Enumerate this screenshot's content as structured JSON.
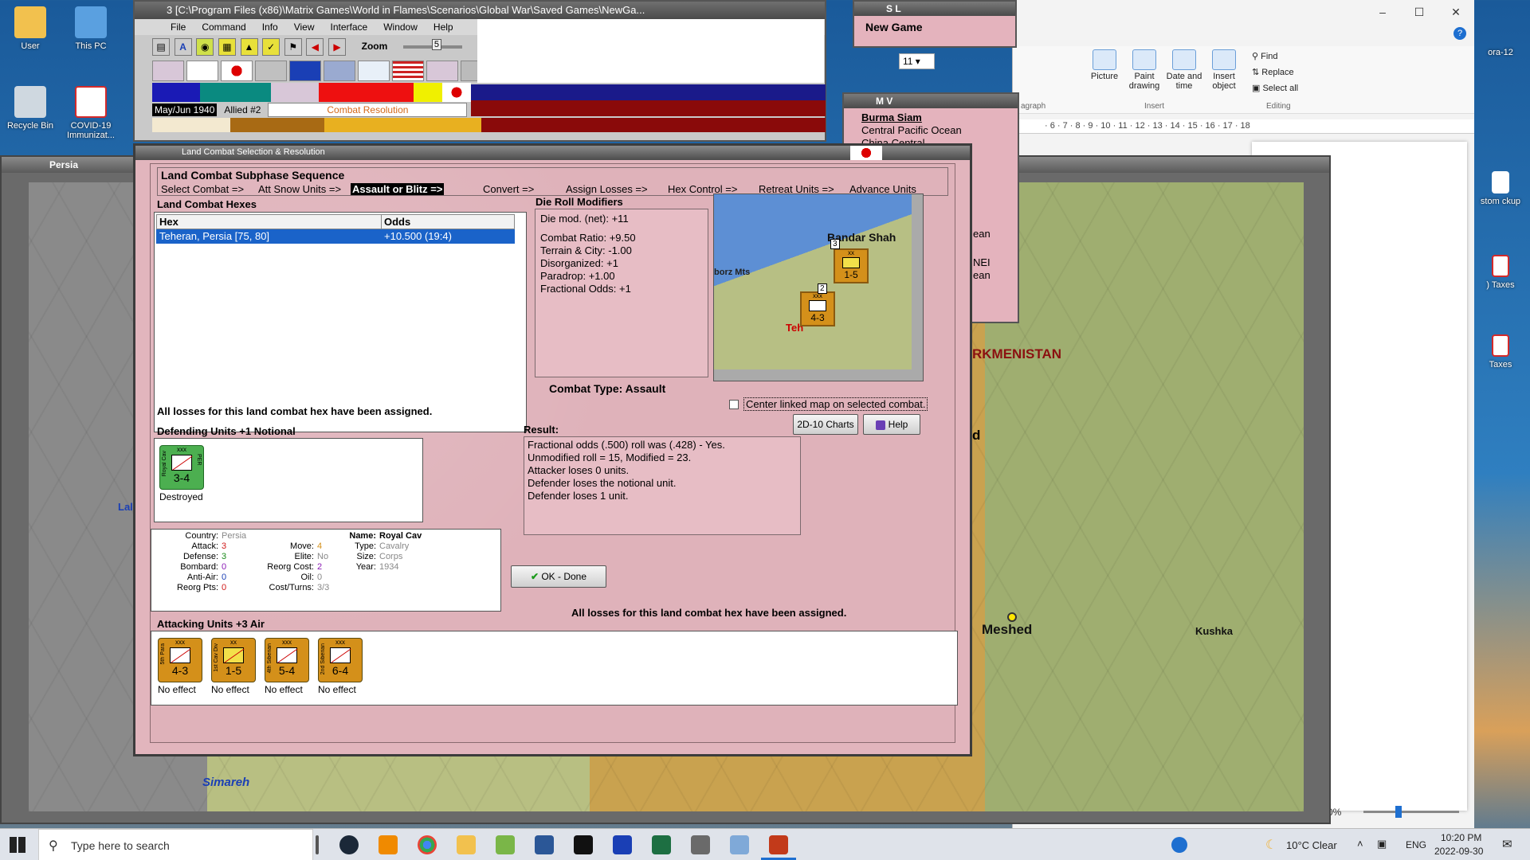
{
  "desktop": {
    "icons": [
      {
        "label": "User"
      },
      {
        "label": "This PC"
      },
      {
        "label": "Recycle Bin"
      },
      {
        "label": "COVID-19 Immunizat..."
      }
    ],
    "right_icons": [
      {
        "label": "ora-12"
      },
      {
        "label": "stom\nckup"
      },
      {
        "label": ") Taxes"
      },
      {
        "label": "Taxes"
      }
    ]
  },
  "word": {
    "font_size": "11",
    "ribbon": {
      "picture": "Picture",
      "paint_drawing": "Paint drawing",
      "date_time": "Date and time",
      "insert_object": "Insert object",
      "find": "Find",
      "replace": "Replace",
      "select_all": "Select all",
      "group_paragraph": "agraph",
      "group_insert": "Insert",
      "group_editing": "Editing"
    },
    "ruler": "· 6 · 7 · 8 · 9 · 10 · 11 · 12 · 13 · 14 · 15 · 16 · 17 · 18",
    "zoom": "0%"
  },
  "wif": {
    "title": "3 [C:\\Program Files (x86)\\Matrix Games\\World in Flames\\Scenarios\\Global War\\Saved Games\\NewGa...",
    "menu": [
      "File",
      "Command",
      "Info",
      "View",
      "Interface",
      "Window",
      "Help"
    ],
    "zoom_label": "Zoom",
    "zoom_value": "5",
    "date": "May/Jun 1940",
    "impulse": "Allied #2",
    "phase": "Combat Resolution"
  },
  "sl_panel": {
    "title": "S L",
    "text": "New Game"
  },
  "mv_panel": {
    "title": "M V",
    "items": [
      "Burma Siam",
      "Central Pacific Ocean",
      "China Central"
    ],
    "extra": [
      "ean",
      "NEI",
      "ean"
    ]
  },
  "map": {
    "window_title": "Persia",
    "labels": {
      "turkmenistan": "RKMENISTAN",
      "meshed": "Meshed",
      "kushka": "Kushka",
      "simareh": "Simareh",
      "lal": "Lal",
      "d": "d"
    }
  },
  "dialog": {
    "title": "Land Combat Selection & Resolution",
    "sequence_title": "Land Combat Subphase Sequence",
    "steps": [
      "Select Combat =>",
      "Att Snow Units =>",
      "Assault or Blitz =>",
      "Convert =>",
      "Assign Losses =>",
      "Hex Control =>",
      "Retreat Units =>",
      "Advance Units"
    ],
    "hexes_title": "Land Combat Hexes",
    "hex_col": "Hex",
    "odds_col": "Odds",
    "hex_rows": [
      {
        "hex": "Teheran, Persia [75, 80]",
        "odds": "+10.500 (19:4)"
      }
    ],
    "drm_title": "Die Roll Modifiers",
    "drm_lines": [
      "Die mod. (net): +11",
      "",
      "Combat Ratio: +9.50",
      "Terrain & City: -1.00",
      "Disorganized: +1",
      "Paradrop: +1.00",
      "Fractional Odds: +1"
    ],
    "combat_type": "Combat Type:  Assault",
    "center_linked": "Center linked map on selected combat.",
    "charts_button": "2D-10 Charts",
    "help_button": "Help",
    "losses_msg_1": "All losses for this land combat hex have been assigned.",
    "defending_title": "Defending Units +1 Notional",
    "defender": {
      "top": "xxx",
      "side": "Royal Cav",
      "right": "PER",
      "value": "3-4",
      "status": "Destroyed"
    },
    "result_title": "Result:",
    "result_lines": [
      "Fractional odds (.500) roll was (.428)  - Yes.",
      "Unmodified roll = 15, Modified = 23.",
      "Attacker loses 0 units.",
      "Defender loses the notional unit.",
      "Defender loses 1 unit."
    ],
    "unit_info": {
      "country_label": "Country:",
      "country": "Persia",
      "attack_label": "Attack:",
      "attack": "3",
      "defense_label": "Defense:",
      "defense": "3",
      "bombard_label": "Bombard:",
      "bombard": "0",
      "antiair_label": "Anti-Air:",
      "antiair": "0",
      "reorg_label": "Reorg Pts:",
      "reorg": "0",
      "move_label": "Move:",
      "move": "4",
      "elite_label": "Elite:",
      "elite": "No",
      "reorgcost_label": "Reorg Cost:",
      "reorgcost": "2",
      "oil_label": "Oil:",
      "oil": "0",
      "costturns_label": "Cost/Turns:",
      "costturns": "3/3",
      "name_label": "Name:",
      "name": "Royal Cav",
      "type_label": "Type:",
      "type": "Cavalry",
      "size_label": "Size:",
      "size": "Corps",
      "year_label": "Year:",
      "year": "1934"
    },
    "ok_button": "OK - Done",
    "losses_msg_2": "All losses for this land combat hex have been assigned.",
    "attacking_title": "Attacking Units +3 Air",
    "attackers": [
      {
        "top": "xxx",
        "side": "5th Para",
        "value": "4-3",
        "status": "No effect"
      },
      {
        "top": "xx",
        "side": "1st Cav Div",
        "value": "1-5",
        "status": "No effect"
      },
      {
        "top": "xxx",
        "side": "4th Siberian",
        "value": "5-4",
        "status": "No effect"
      },
      {
        "top": "xxx",
        "side": "2nd Siberian",
        "value": "6-4",
        "status": "No effect"
      }
    ],
    "minimap": {
      "label_bandar": "Bandar Shah",
      "label_mts": "borz Mts",
      "label_teh": "Teh",
      "stack1": "1-5",
      "stack2": "4-3",
      "stack1_top": "xx",
      "stack2_top": "xxx",
      "stack1_count": "3",
      "stack2_count": "2"
    }
  },
  "taskbar": {
    "search": "Type here to search",
    "weather": "10°C  Clear",
    "lang": "ENG",
    "time": "10:20 PM",
    "date": "2022-09-30"
  },
  "colors": {
    "dialog_bg": "#e2b5bd",
    "selection": "#1a63c9",
    "unit_green": "#4caf50",
    "unit_orange": "#d4901a"
  }
}
